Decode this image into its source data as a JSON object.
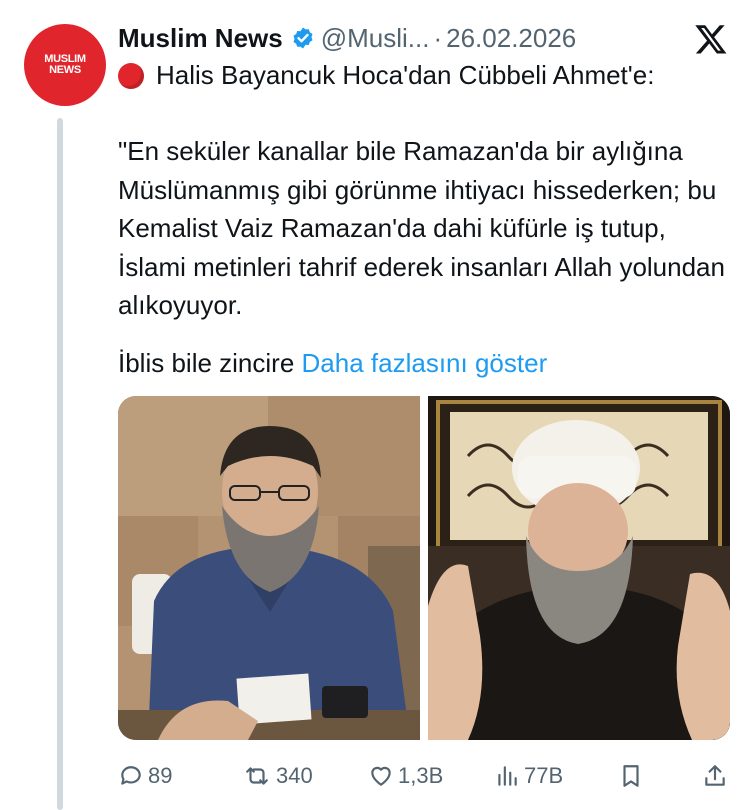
{
  "author": {
    "avatar_text_line1": "MUSLIM",
    "avatar_text_line2": "NEWS",
    "name": "Muslim News",
    "handle": "@Musli...",
    "separator": "·",
    "date": "26.02.2026"
  },
  "tweet": {
    "title": "Halis Bayancuk Hoca'dan Cübbeli Ahmet'e:",
    "body": "\"En seküler kanallar bile Ramazan'da bir aylığına Müslümanmış gibi görünme ihtiyacı hissederken; bu Kemalist Vaiz Ramazan'da dahi küfürle iş tutup, İslami metinleri tahrif ederek insanları Allah yolundan alıkoyuyor.",
    "truncated_text": "İblis bile zincire",
    "show_more_label": "Daha fazlasını göster"
  },
  "actions": {
    "replies": "89",
    "retweets": "340",
    "likes": "1,3B",
    "views": "77B"
  },
  "icons": {
    "verified": "verified-badge-icon",
    "x_logo": "x-logo-icon",
    "reply": "reply-icon",
    "retweet": "retweet-icon",
    "like": "heart-icon",
    "views": "views-icon",
    "bookmark": "bookmark-icon",
    "share": "share-icon"
  },
  "colors": {
    "accent": "#1d9bf0",
    "brand_red": "#e0262c",
    "text_primary": "#0f1419",
    "text_secondary": "#536471"
  }
}
